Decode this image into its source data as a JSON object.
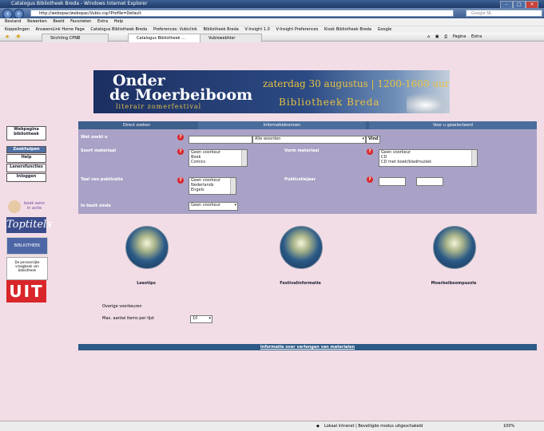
{
  "window": {
    "title": "Catalogus Bibliotheek Breda - Windows Internet Explorer",
    "address": "http://webopac/webopac/Vubis.csp?Profile=Default",
    "search_placeholder": "Google NL"
  },
  "menu": [
    "Bestand",
    "Bewerken",
    "Beeld",
    "Favorieten",
    "Extra",
    "Help"
  ],
  "links": [
    "Koppelingen",
    "AnswersLink Home Page",
    "Catalogus Bibliotheek Breda",
    "Preferences: Vubiclink",
    "Bibliotheek Breda",
    "V-Insight 1.0",
    "V-Insight Preferences",
    "Kiosk Bibliotheek Breda",
    "Google"
  ],
  "tabs": [
    "Stichting CPNB",
    "Catalogus Bibliotheek ...",
    "Vubiswebhier"
  ],
  "tools": [
    "Pagina",
    "Extra"
  ],
  "banner": {
    "line1": "Onder",
    "line2": "de Moerbeiboom",
    "line3": "literair zomerfestival",
    "date": "zaterdag 30 augustus | 1200-1600 uur",
    "library": "Bibliotheek Breda"
  },
  "nav": {
    "webpagina": "Webpagina bibliotheek",
    "zoeken": "Zoekhulpen",
    "help": "Help",
    "lenersfuncties": "Lenersfuncties",
    "inloggen": "Inloggen"
  },
  "promos": {
    "boekenbeurs": "boek eens in actie",
    "toptitels": "Toptitels",
    "bibliotheek": "BIBLIOTHEEK BREDA",
    "persoonlijk": "De persoonlijke vraagbaak van bibliotheek",
    "uit": "UIT"
  },
  "search": {
    "tabs": [
      "Direct zoeken",
      "Informatiebronnen",
      "Voor u geselecteerd"
    ],
    "wat_zoekt_u": "Wat zoekt u",
    "query_value": "",
    "woorden_value": "Alle woorden",
    "vind_button": "Vind",
    "soort_materiaal": "Soort materiaal",
    "materiaal_options": [
      "Geen voorkeur",
      "Boek",
      "Comics"
    ],
    "vorm_materiaal": "Vorm materiaal",
    "vorm_options": [
      "Geen voorkeur",
      "CD",
      "CD met boek/bladmuziek"
    ],
    "taal": "Taal van publicatie",
    "taal_options": [
      "Geen voorkeur",
      "Nederlands",
      "Engels"
    ],
    "publicatiejaar": "Publicatiejaar",
    "in_bezit": "In bezit sinds",
    "in_bezit_value": "Geen voorkeur"
  },
  "features": [
    {
      "label": "Leestips"
    },
    {
      "label": "Festivalinformatie"
    },
    {
      "label": "Moerbeiboompuzzle"
    }
  ],
  "other": {
    "label": "Overige voorkeuren",
    "max_label": "Max. aantal items per lijst",
    "max_value": "10"
  },
  "footer_link": "Informatie over verlengen van materialen",
  "status": {
    "zone": "Lokaal intranet | Beveiligde modus uitgeschakeld",
    "zoom": "100%"
  }
}
